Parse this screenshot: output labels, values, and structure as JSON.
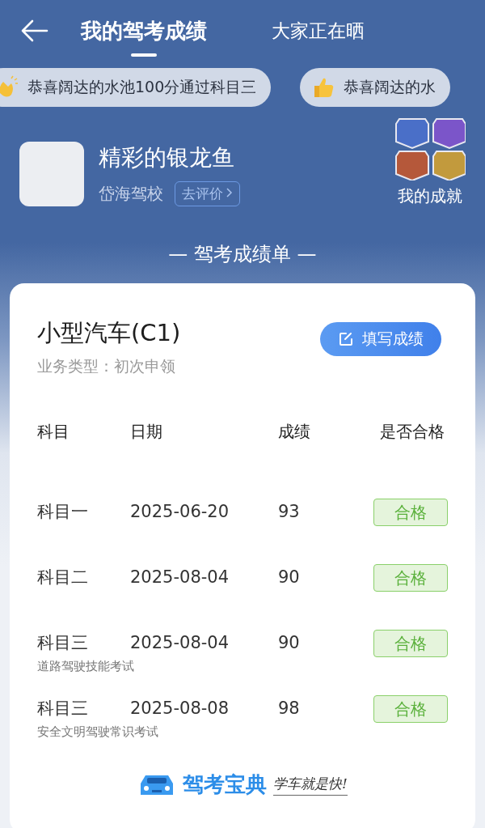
{
  "header": {
    "back": true,
    "tabs": [
      {
        "label": "我的驾考成绩",
        "selected": true
      },
      {
        "label": "大家正在晒",
        "selected": false
      }
    ]
  },
  "ticker": [
    {
      "kind": "clap",
      "text": "恭喜阔达的水池100分通过科目三"
    },
    {
      "kind": "thumb",
      "text": "恭喜阔达的水"
    }
  ],
  "profile": {
    "name": "精彩的银龙鱼",
    "school": "岱海驾校",
    "review_button": "去评价",
    "achievements_label": "我的成就"
  },
  "section_title": "— 驾考成绩单 —",
  "card": {
    "title": "小型汽车(C1)",
    "subtitle": "业务类型：初次申领",
    "fill_button": "填写成绩",
    "columns": [
      "科目",
      "日期",
      "成绩",
      "是否合格"
    ],
    "rows": [
      {
        "subject": "科目一",
        "date": "2025-06-20",
        "score": "93",
        "result": "合格",
        "passed": true
      },
      {
        "subject": "科目二",
        "date": "2025-08-04",
        "score": "90",
        "result": "合格",
        "passed": true
      },
      {
        "subject": "科目三",
        "note": "道路驾驶技能考试",
        "date": "2025-08-04",
        "score": "90",
        "result": "合格",
        "passed": true
      },
      {
        "subject": "科目三",
        "note": "安全文明驾驶常识考试",
        "date": "2025-08-08",
        "score": "98",
        "result": "合格",
        "passed": true
      }
    ],
    "brand": {
      "name": "驾考宝典",
      "slogan": "学车就是快!"
    }
  }
}
